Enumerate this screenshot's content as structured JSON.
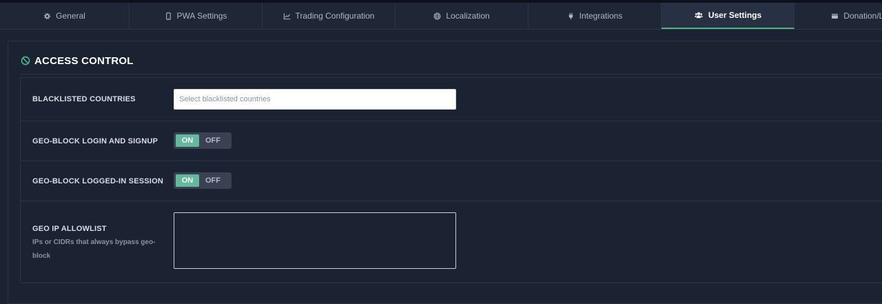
{
  "tabs": [
    {
      "label": "General",
      "icon": "gear-icon"
    },
    {
      "label": "PWA Settings",
      "icon": "mobile-icon"
    },
    {
      "label": "Trading Configuration",
      "icon": "chart-line-icon"
    },
    {
      "label": "Localization",
      "icon": "globe-icon"
    },
    {
      "label": "Integrations",
      "icon": "plug-icon"
    },
    {
      "label": "User Settings",
      "icon": "users-icon",
      "active": true
    },
    {
      "label": "Donation/Liq",
      "icon": "wallet-icon"
    }
  ],
  "section": {
    "title": "ACCESS CONTROL",
    "icon": "ban-icon",
    "accent_color": "#4fb08a"
  },
  "fields": {
    "blacklisted_countries": {
      "label": "BLACKLISTED COUNTRIES",
      "placeholder": "Select blacklisted countries",
      "value": ""
    },
    "geo_block_login": {
      "label": "GEO-BLOCK LOGIN AND SIGNUP",
      "on_label": "ON",
      "off_label": "OFF",
      "state": "on"
    },
    "geo_block_session": {
      "label": "GEO-BLOCK LOGGED-IN SESSION",
      "on_label": "ON",
      "off_label": "OFF",
      "state": "on"
    },
    "geo_ip_allowlist": {
      "label": "GEO IP ALLOWLIST",
      "help": "IPs or CIDRs that always bypass geo-block",
      "value": ""
    }
  },
  "colors": {
    "toggle_on": "#62b99c",
    "active_tab_underline": "#4fb08a"
  }
}
